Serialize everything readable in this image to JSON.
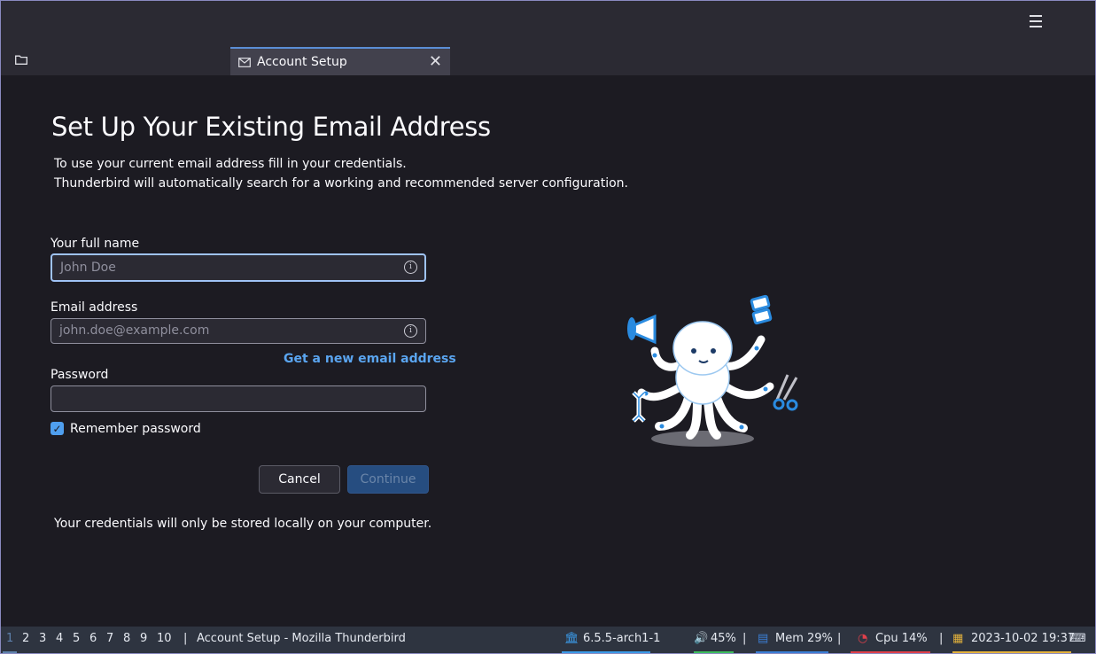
{
  "window": {
    "tab_label": "Account Setup"
  },
  "page": {
    "title": "Set Up Your Existing Email Address",
    "intro_line1": "To use your current email address fill in your credentials.",
    "intro_line2": "Thunderbird will automatically search for a working and recommended server configuration."
  },
  "form": {
    "name_label": "Your full name",
    "name_placeholder": "John Doe",
    "email_label": "Email address",
    "email_placeholder": "john.doe@example.com",
    "new_email_link": "Get a new email address",
    "password_label": "Password",
    "password_value": "",
    "remember_label": "Remember password",
    "remember_checked": true,
    "cancel_label": "Cancel",
    "continue_label": "Continue",
    "footnote": "Your credentials will only be stored locally on your computer."
  },
  "taskbar": {
    "workspaces": [
      "1",
      "2",
      "3",
      "4",
      "5",
      "6",
      "7",
      "8",
      "9",
      "10"
    ],
    "active_workspace": "1",
    "separator": "|",
    "window_title": "Account Setup - Mozilla Thunderbird",
    "kernel": "6.5.5-arch1-1",
    "volume": "45%",
    "memory": "Mem 29%",
    "cpu": "Cpu  14%",
    "datetime": "2023-10-02 19:37"
  },
  "colors": {
    "accent": "#4f9fef",
    "link": "#5aa5f0",
    "continue_bg": "#264d80",
    "background": "#1c1b22",
    "kernel_bar": "#3b9ae8",
    "volume_bar": "#3dbd5d",
    "memory_bar": "#3b7fd6",
    "cpu_bar": "#e0404b",
    "date_bar": "#e3b23c"
  }
}
